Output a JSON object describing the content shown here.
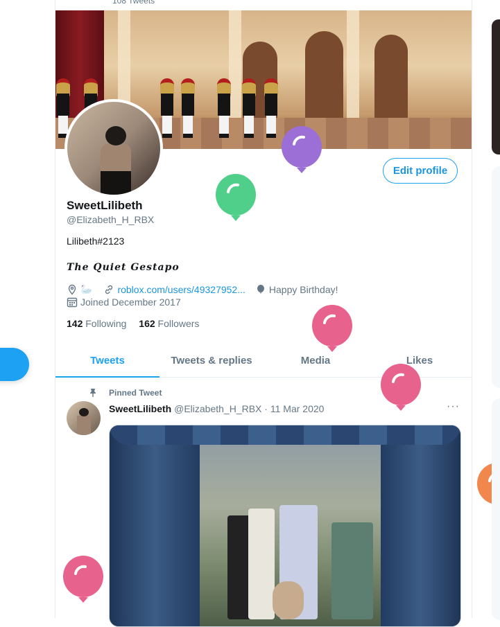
{
  "header": {
    "tweet_count": "108 Tweets"
  },
  "profile": {
    "display_name": "SweetLilibeth",
    "handle": "@Elizabeth_H_RBX",
    "bio_line1": "Lilibeth#2123",
    "bio_line2": "The Quiet Gestapo",
    "location_emoji": "🦢",
    "website": "roblox.com/users/49327952...",
    "birthday": "Happy Birthday!",
    "joined": "Joined December 2017",
    "following_count": "142",
    "following_label": "Following",
    "followers_count": "162",
    "followers_label": "Followers",
    "edit_button": "Edit profile"
  },
  "tabs": [
    {
      "label": "Tweets",
      "active": true
    },
    {
      "label": "Tweets & replies",
      "active": false
    },
    {
      "label": "Media",
      "active": false
    },
    {
      "label": "Likes",
      "active": false
    }
  ],
  "tweet": {
    "pinned_label": "Pinned Tweet",
    "author_name": "SweetLilibeth",
    "author_handle": "@Elizabeth_H_RBX",
    "separator": "·",
    "date": "11 Mar 2020",
    "more": "···"
  },
  "colors": {
    "accent": "#1da1f2",
    "balloon_purple": "#9b6fd6",
    "balloon_green": "#4fcf8a",
    "balloon_pink": "#e8628e",
    "balloon_orange": "#f2874e"
  }
}
